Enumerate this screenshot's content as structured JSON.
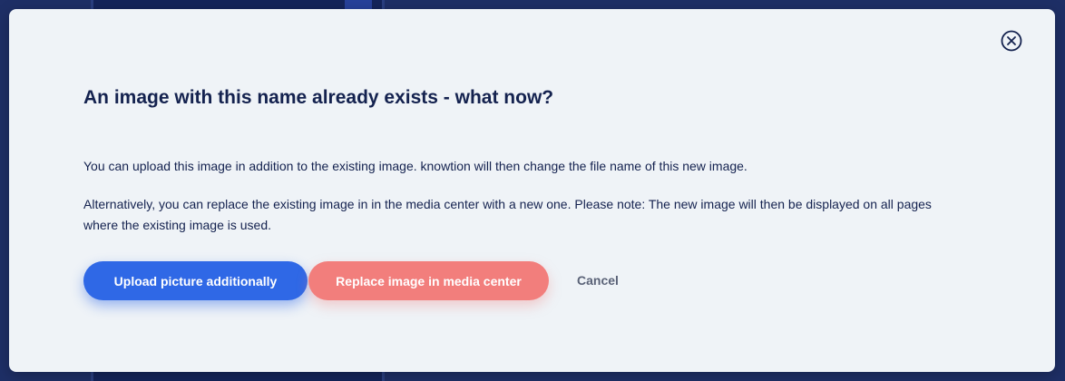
{
  "dialog": {
    "title": "An image with this name already exists - what now?",
    "paragraph_1": "You can upload this image in addition to the existing image. knowtion will then change the file name of this new image.",
    "paragraph_2": "Alternatively, you can replace the existing image in in the media center with a new one. Please note: The new image will then be displayed on all pages where the existing image is used.",
    "close_icon": "close-circle-icon"
  },
  "actions": {
    "upload_label": "Upload picture additionally",
    "replace_label": "Replace image in media center",
    "cancel_label": "Cancel"
  },
  "colors": {
    "primary": "#2f68e6",
    "danger": "#f27e7c",
    "text_dark": "#14224f",
    "modal_bg": "#eff3f7",
    "backdrop": "#1e2f66"
  }
}
